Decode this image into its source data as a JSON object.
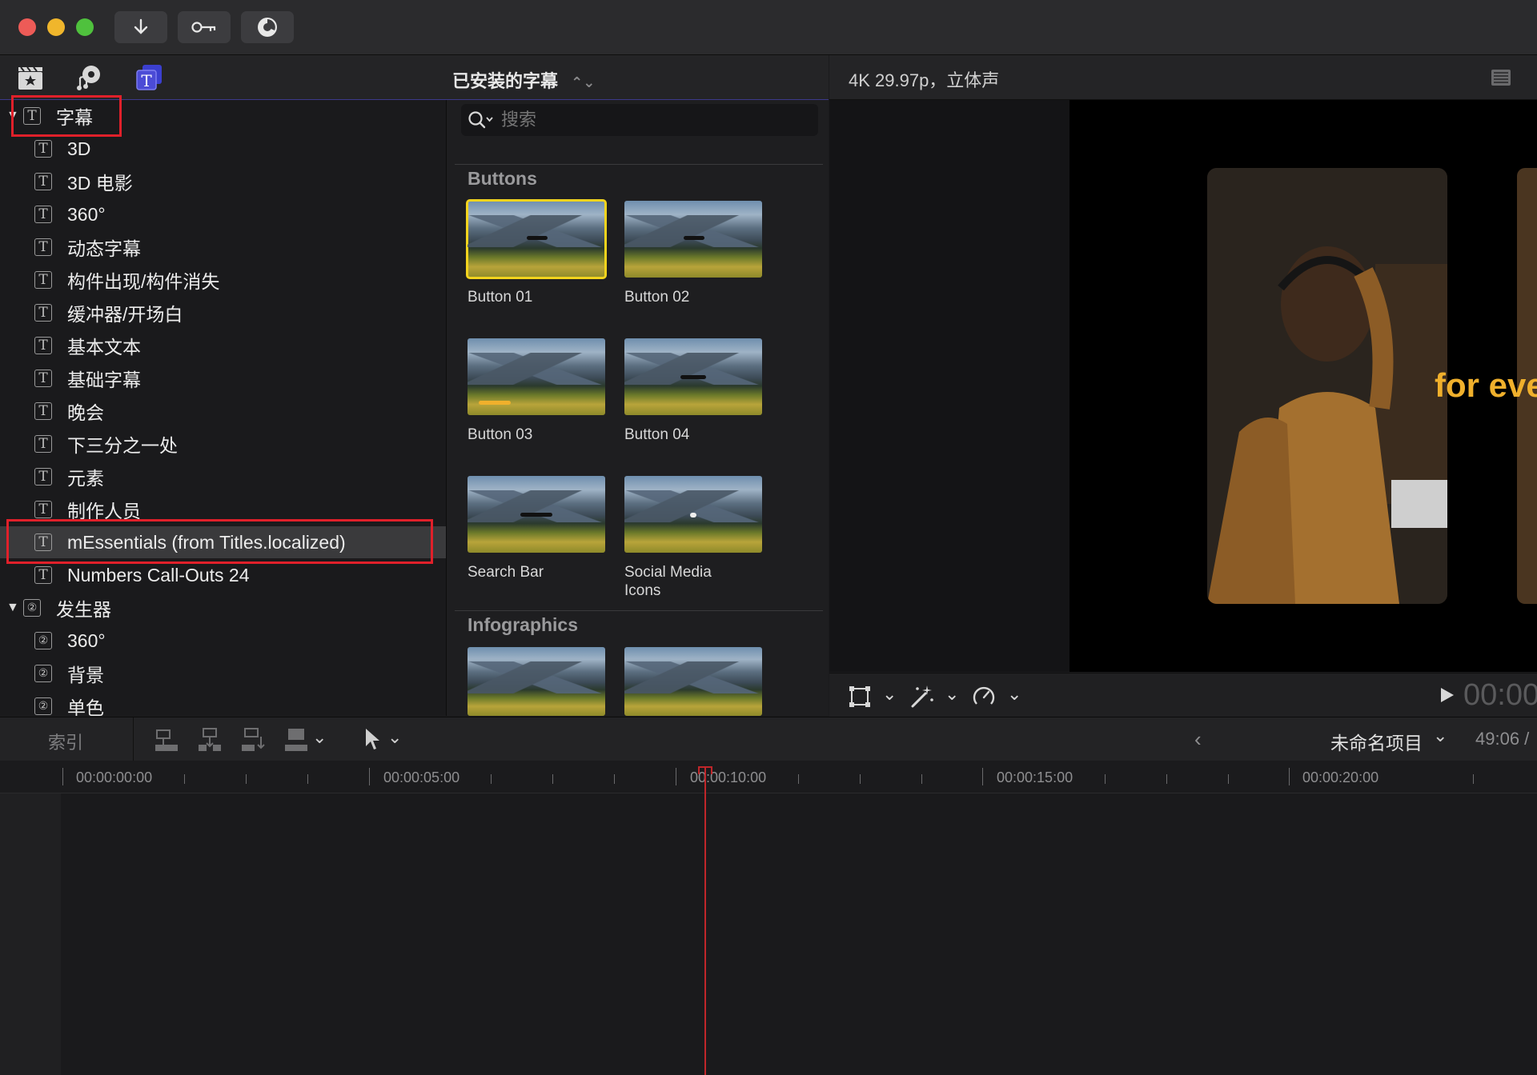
{
  "window": {
    "toolbar_icons": [
      "import-icon",
      "keyword-icon",
      "background-tasks-icon"
    ]
  },
  "library_tabs": [
    "photos-and-videos-icon",
    "music-and-sound-icon",
    "titles-and-generators-icon"
  ],
  "browser": {
    "title": "已安装的字幕",
    "search_placeholder": "搜索"
  },
  "sidebar": {
    "groups": [
      {
        "label": "字幕",
        "items": [
          "3D",
          "3D 电影",
          "360°",
          "动态字幕",
          "构件出现/构件消失",
          "缓冲器/开场白",
          "基本文本",
          "基础字幕",
          "晚会",
          "下三分之一处",
          "元素",
          "制作人员",
          "mEssentials (from Titles.localized)",
          "Numbers Call-Outs 24"
        ]
      },
      {
        "label": "发生器",
        "items": [
          "360°",
          "背景",
          "单色"
        ]
      }
    ]
  },
  "thumbnails": {
    "sections": [
      {
        "title": "Buttons",
        "items": [
          "Button 01",
          "Button 02",
          "Button 03",
          "Button 04",
          "Search Bar",
          "Social Media Icons"
        ]
      },
      {
        "title": "Infographics",
        "items": []
      }
    ]
  },
  "viewer": {
    "format": "4K 29.97p，立体声",
    "overlay_text": "for eve",
    "timecode": "00:00"
  },
  "timeline": {
    "index_label": "索引",
    "project_name": "未命名项目",
    "duration": "49:06 /",
    "ruler": [
      "00:00:00:00",
      "00:00:05:00",
      "00:00:10:00",
      "00:00:15:00",
      "00:00:20:00"
    ]
  },
  "colors": {
    "selection_outline": "#f3d41d",
    "annotation_red": "#e0202a",
    "playhead": "#c0262a",
    "accent_tab": "#4b4bd6"
  }
}
